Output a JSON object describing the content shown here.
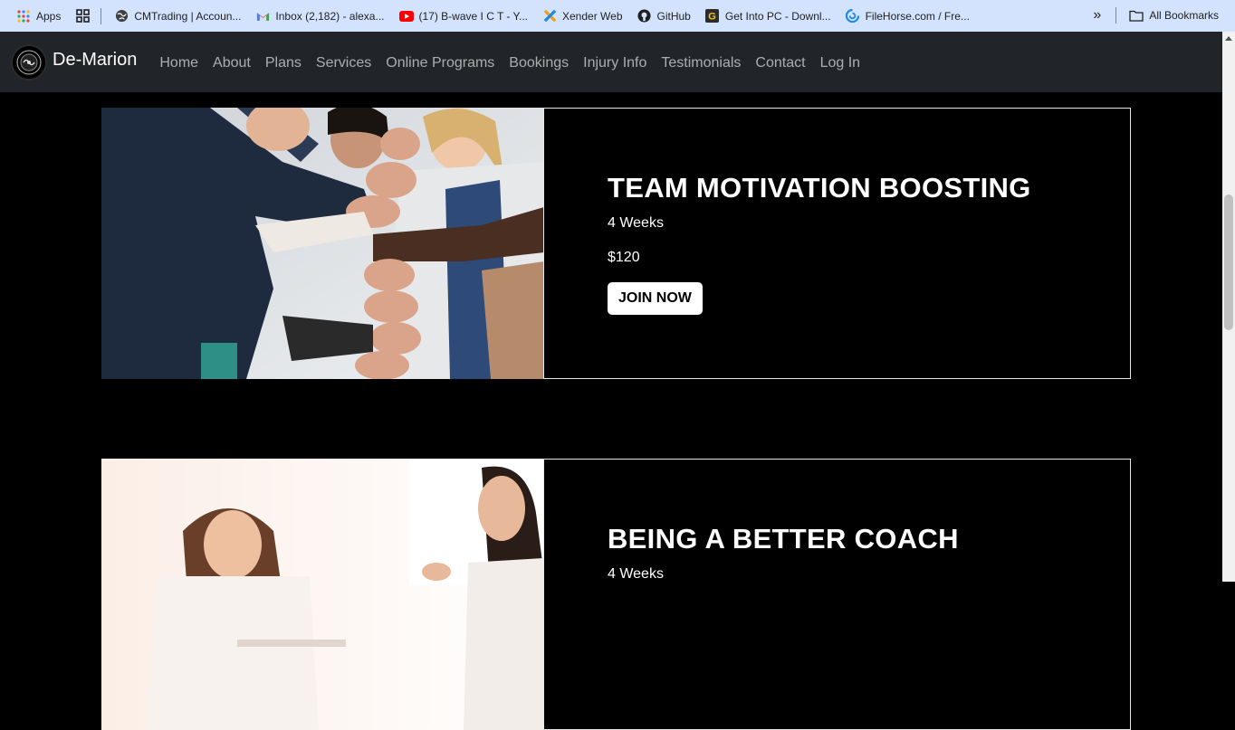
{
  "bookmarks": {
    "items": [
      {
        "label": "Apps",
        "icon": "apps-icon"
      },
      {
        "label": "",
        "icon": "grid-icon"
      },
      {
        "label": "CMTrading | Accoun...",
        "icon": "globe-icon"
      },
      {
        "label": "Inbox (2,182) - alexa...",
        "icon": "gmail-icon"
      },
      {
        "label": "(17) B-wave I C T - Y...",
        "icon": "youtube-icon"
      },
      {
        "label": "Xender Web",
        "icon": "xender-icon"
      },
      {
        "label": "GitHub",
        "icon": "github-icon"
      },
      {
        "label": "Get Into PC - Downl...",
        "icon": "getintopc-icon"
      },
      {
        "label": "FileHorse.com / Fre...",
        "icon": "filehorse-icon"
      }
    ],
    "overflow_label": "»",
    "all_bookmarks_label": "All Bookmarks"
  },
  "navbar": {
    "brand": "De-Marion",
    "links": [
      "Home",
      "About",
      "Plans",
      "Services",
      "Online Programs",
      "Bookings",
      "Injury Info",
      "Testimonials",
      "Contact",
      "Log In"
    ]
  },
  "plans": [
    {
      "title": "TEAM MOTIVATION BOOSTING",
      "duration": "4 Weeks",
      "price": "$120",
      "button": "JOIN NOW"
    },
    {
      "title": "BEING A BETTER COACH",
      "duration": "4 Weeks",
      "price": "",
      "button": ""
    }
  ],
  "colors": {
    "bookmarks_bg": "#d3e3fd",
    "navbar_bg": "#212529",
    "page_bg": "#000000"
  }
}
